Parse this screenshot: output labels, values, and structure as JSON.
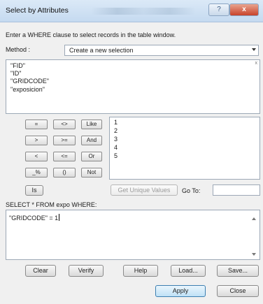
{
  "window": {
    "title": "Select by Attributes",
    "help_label": "?",
    "close_label": "x"
  },
  "instructions": "Enter a WHERE clause to select records in the table window.",
  "method": {
    "label": "Method :",
    "value": "Create a new selection"
  },
  "fields": [
    "\"FID\"",
    "\"ID\"",
    "\"GRIDCODE\"",
    "\"exposicion\""
  ],
  "fields_scroll_indicator": "x",
  "operators": {
    "row1": [
      "=",
      "<>",
      "Like"
    ],
    "row2": [
      ">",
      ">=",
      "And"
    ],
    "row3": [
      "<",
      "<=",
      "Or"
    ],
    "row4": [
      "_%",
      "()",
      "Not"
    ]
  },
  "values": [
    "1",
    "2",
    "3",
    "4",
    "5"
  ],
  "is_label": "Is",
  "get_unique_values_label": "Get Unique Values",
  "goto": {
    "label": "Go To:",
    "value": ""
  },
  "sql_prefix": "SELECT * FROM expo WHERE:",
  "where_clause": "\"GRIDCODE\" = 1",
  "buttons": {
    "clear": "Clear",
    "verify": "Verify",
    "help": "Help",
    "load": "Load...",
    "save": "Save...",
    "apply": "Apply",
    "close": "Close"
  }
}
